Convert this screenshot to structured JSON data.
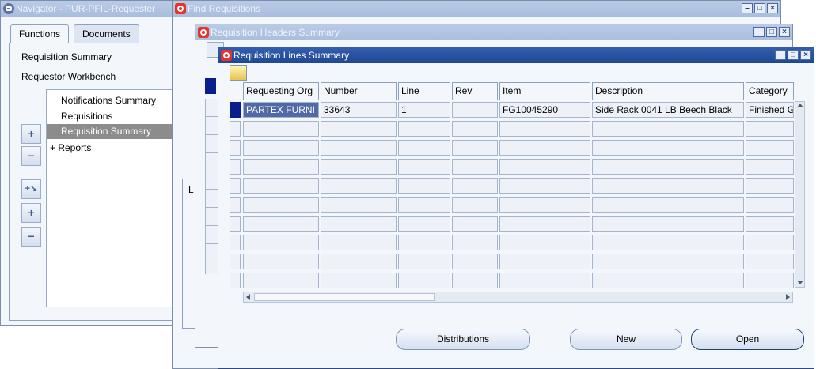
{
  "navigator": {
    "title": "Navigator - PUR-PFIL-Requester",
    "tabs": [
      "Functions",
      "Documents"
    ],
    "top_links": [
      "Requisition Summary",
      "Requestor Workbench"
    ],
    "list_items": [
      "Notifications Summary",
      "Requisitions",
      "Requisition Summary",
      "+  Reports"
    ],
    "side_buttons": [
      "+",
      "−",
      "+↘",
      "+",
      "−"
    ]
  },
  "find_window": {
    "title": "Find Requisitions"
  },
  "headers_window": {
    "title": "Requisition Headers Summary",
    "partial_label": "L"
  },
  "lines_window": {
    "title": "Requisition Lines Summary",
    "columns": [
      "Requesting Org",
      "Number",
      "Line",
      "Rev",
      "Item",
      "Description",
      "Category"
    ],
    "rows": [
      [
        "PARTEX FURNI",
        "33643",
        "1",
        "",
        "FG10045290",
        "Side Rack 0041 LB Beech Black",
        "Finished G"
      ]
    ],
    "buttons": {
      "distributions": "Distributions",
      "new": "New",
      "open": "Open"
    }
  },
  "colors": {
    "title_active": "#1f4794",
    "title_inactive": "#b9cbe6",
    "selected_row": "#0a1d8c",
    "selected_cell": "#4f6aa7"
  }
}
